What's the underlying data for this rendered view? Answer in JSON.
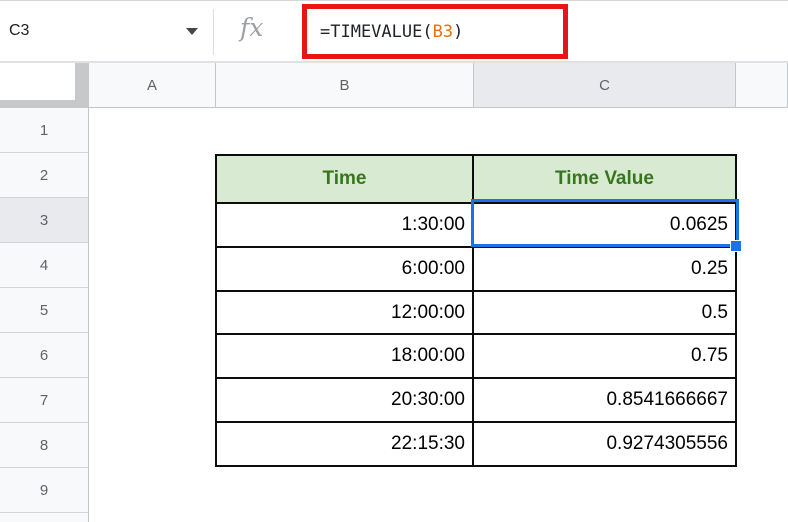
{
  "name_box": {
    "value": "C3"
  },
  "formula_bar": {
    "fx_icon": "fx",
    "formula_prefix": "=TIMEVALUE(",
    "formula_ref": "B3",
    "formula_suffix": ")"
  },
  "grid": {
    "column_headers": [
      "A",
      "B",
      "C"
    ],
    "row_headers": [
      "1",
      "2",
      "3",
      "4",
      "5",
      "6",
      "7",
      "8",
      "9"
    ],
    "selected_cell": "C3",
    "selected_column": "C",
    "selected_row": "3"
  },
  "table": {
    "headers": [
      "Time",
      "Time Value"
    ],
    "rows": [
      [
        "1:30:00",
        "0.0625"
      ],
      [
        "6:00:00",
        "0.25"
      ],
      [
        "12:00:00",
        "0.5"
      ],
      [
        "18:00:00",
        "0.75"
      ],
      [
        "20:30:00",
        "0.8541666667"
      ],
      [
        "22:15:30",
        "0.9274305556"
      ]
    ]
  },
  "colors": {
    "table_header_bg": "#d9ead3",
    "table_header_text": "#38761d",
    "selection_blue": "#1a73e8",
    "annotation_red": "#e81515",
    "formula_ref_orange": "#e8710a",
    "header_selected_bg": "#e8eaed"
  }
}
